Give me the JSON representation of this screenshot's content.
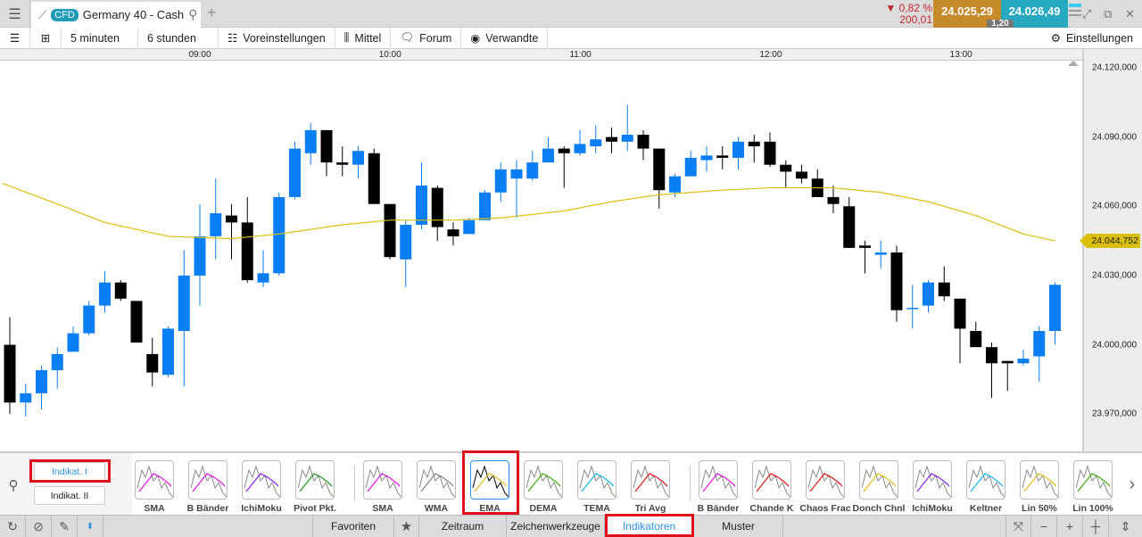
{
  "header": {
    "tab_badge": "CFD",
    "tab_title": "Germany 40 - Cash",
    "change_pct": "▼ 0,82 %",
    "change_abs": "200,01",
    "bid": "24.025,29",
    "ask": "24.026,49",
    "spread": "1,20"
  },
  "toolbar": {
    "interval": "5 minuten",
    "range": "6 stunden",
    "presets": "Voreinstellungen",
    "chart_type": "Mittel",
    "forum": "Forum",
    "related": "Verwandte",
    "settings": "Einstellungen"
  },
  "colors": {
    "up": "#0a7ff5",
    "down": "#000000",
    "ema": "#d9be0c",
    "accent": "#2b8fe6",
    "highlight": "#e0101a"
  },
  "indicator_panel": {
    "tabs": [
      {
        "label": "Indikat. I",
        "active": true
      },
      {
        "label": "Indikat. II",
        "active": false
      }
    ],
    "groups": [
      [
        {
          "label": "SMA",
          "c": "#e020e0"
        },
        {
          "label": "B Bänder",
          "c": "#e020e0"
        },
        {
          "label": "IchiMoku",
          "c": "#8a2be2"
        },
        {
          "label": "Pivot Pkt.",
          "c": "#2a9a2a"
        }
      ],
      [
        {
          "label": "SMA",
          "c": "#e020e0"
        },
        {
          "label": "WMA",
          "c": "#888888"
        },
        {
          "label": "EMA",
          "c": "#e0c020",
          "selected": true
        },
        {
          "label": "DEMA",
          "c": "#4caf20"
        },
        {
          "label": "TEMA",
          "c": "#20b8e8"
        },
        {
          "label": "Tri Avg",
          "c": "#e02020"
        }
      ],
      [
        {
          "label": "B Bänder",
          "c": "#e020e0"
        },
        {
          "label": "Chande K",
          "c": "#e02020"
        },
        {
          "label": "Chaos Frac",
          "c": "#e02020"
        },
        {
          "label": "Donch Chnl",
          "c": "#e0c020"
        },
        {
          "label": "IchiMoku",
          "c": "#8a2be2"
        },
        {
          "label": "Keltner",
          "c": "#20b8e8"
        },
        {
          "label": "Lin 50%",
          "c": "#e0c020"
        },
        {
          "label": "Lin 100%",
          "c": "#4caf20"
        }
      ]
    ]
  },
  "bottom_tabs": [
    {
      "label": "Favoriten"
    },
    {
      "label": "Zeitraum"
    },
    {
      "label": "Zeichenwerkzeuge"
    },
    {
      "label": "Indikatoren",
      "active": true
    },
    {
      "label": "Muster"
    }
  ],
  "chart_data": {
    "type": "candlestick",
    "instrument": "Germany 40 - Cash",
    "interval": "5 minuten",
    "first_candle_time": "08:00",
    "x_ticks": [
      "09:00",
      "10:00",
      "11:00",
      "12:00",
      "13:00"
    ],
    "y_ticks": [
      "24.120,000",
      "24.090,000",
      "24.060,000",
      "24.030,000",
      "24.000,000",
      "23.970,000"
    ],
    "ylim": [
      23955,
      24123
    ],
    "last_ema_label": "24.044,752",
    "ohlc": [
      [
        24000,
        24012,
        23970,
        23975
      ],
      [
        23975,
        23983,
        23969,
        23979
      ],
      [
        23979,
        23991,
        23972,
        23989
      ],
      [
        23989,
        23999,
        23981,
        23996
      ],
      [
        23997,
        24008,
        23997,
        24005
      ],
      [
        24005,
        24019,
        24004,
        24017
      ],
      [
        24017,
        24032,
        24014,
        24027
      ],
      [
        24027,
        24028,
        24019,
        24020
      ],
      [
        24019,
        24019,
        24001,
        24001
      ],
      [
        23996,
        24003,
        23982,
        23988
      ],
      [
        23987,
        24008,
        23986,
        24007
      ],
      [
        24006,
        24041,
        23982,
        24030
      ],
      [
        24030,
        24061,
        24017,
        24047
      ],
      [
        24047,
        24072,
        24037,
        24057
      ],
      [
        24056,
        24061,
        24037,
        24053
      ],
      [
        24053,
        24064,
        24027,
        24028
      ],
      [
        24027,
        24041,
        24025,
        24031
      ],
      [
        24031,
        24066,
        24030,
        24064
      ],
      [
        24064,
        24088,
        24063,
        24085
      ],
      [
        24083,
        24096,
        24078,
        24093
      ],
      [
        24093,
        24093,
        24073,
        24079
      ],
      [
        24079,
        24086,
        24073,
        24078
      ],
      [
        24078,
        24086,
        24072,
        24084
      ],
      [
        24083,
        24085,
        24061,
        24061
      ],
      [
        24061,
        24061,
        24037,
        24038
      ],
      [
        24037,
        24054,
        24025,
        24052
      ],
      [
        24052,
        24079,
        24050,
        24069
      ],
      [
        24068,
        24069,
        24045,
        24051
      ],
      [
        24050,
        24053,
        24043,
        24047
      ],
      [
        24048,
        24055,
        24048,
        24054
      ],
      [
        24054,
        24067,
        24054,
        24066
      ],
      [
        24066,
        24079,
        24062,
        24076
      ],
      [
        24072,
        24080,
        24055,
        24076
      ],
      [
        24072,
        24084,
        24071,
        24079
      ],
      [
        24079,
        24090,
        24079,
        24085
      ],
      [
        24085,
        24086,
        24068,
        24083
      ],
      [
        24083,
        24093,
        24082,
        24087
      ],
      [
        24086,
        24095,
        24083,
        24089
      ],
      [
        24090,
        24094,
        24083,
        24088
      ],
      [
        24088,
        24104,
        24084,
        24091
      ],
      [
        24091,
        24093,
        24080,
        24085
      ],
      [
        24085,
        24085,
        24059,
        24067
      ],
      [
        24066,
        24074,
        24064,
        24073
      ],
      [
        24073,
        24084,
        24073,
        24081
      ],
      [
        24080,
        24086,
        24075,
        24082
      ],
      [
        24082,
        24086,
        24076,
        24081
      ],
      [
        24081,
        24090,
        24076,
        24088
      ],
      [
        24088,
        24091,
        24079,
        24086
      ],
      [
        24088,
        24092,
        24077,
        24078
      ],
      [
        24078,
        24080,
        24068,
        24075
      ],
      [
        24075,
        24078,
        24070,
        24072
      ],
      [
        24072,
        24076,
        24064,
        24064
      ],
      [
        24064,
        24069,
        24057,
        24061
      ],
      [
        24060,
        24064,
        24042,
        24042
      ],
      [
        24043,
        24045,
        24031,
        24042
      ],
      [
        24039,
        24045,
        24033,
        24040
      ],
      [
        24040,
        24043,
        24010,
        24015
      ],
      [
        24016,
        24026,
        24007,
        24016
      ],
      [
        24017,
        24028,
        24014,
        24027
      ],
      [
        24027,
        24034,
        24019,
        24021
      ],
      [
        24020,
        24020,
        23992,
        24007
      ],
      [
        24006,
        24010,
        23999,
        23999
      ],
      [
        23999,
        24001,
        23977,
        23992
      ],
      [
        23993,
        23993,
        23980,
        23992
      ],
      [
        23992,
        23998,
        23991,
        23994
      ],
      [
        23995,
        24008,
        23984,
        24006
      ],
      [
        24006,
        24027,
        24000,
        24026
      ]
    ],
    "ema": [
      [
        -0.5,
        24070
      ],
      [
        3,
        24061
      ],
      [
        6,
        24053
      ],
      [
        10,
        24047
      ],
      [
        14,
        24046
      ],
      [
        17,
        24048
      ],
      [
        21,
        24052
      ],
      [
        24,
        24054
      ],
      [
        28,
        24054
      ],
      [
        31,
        24055
      ],
      [
        35,
        24058
      ],
      [
        38,
        24062
      ],
      [
        41,
        24065
      ],
      [
        45,
        24067
      ],
      [
        48,
        24068
      ],
      [
        52,
        24068
      ],
      [
        55,
        24066
      ],
      [
        58,
        24062
      ],
      [
        61,
        24056
      ],
      [
        64,
        24048
      ],
      [
        66,
        24045
      ]
    ]
  }
}
